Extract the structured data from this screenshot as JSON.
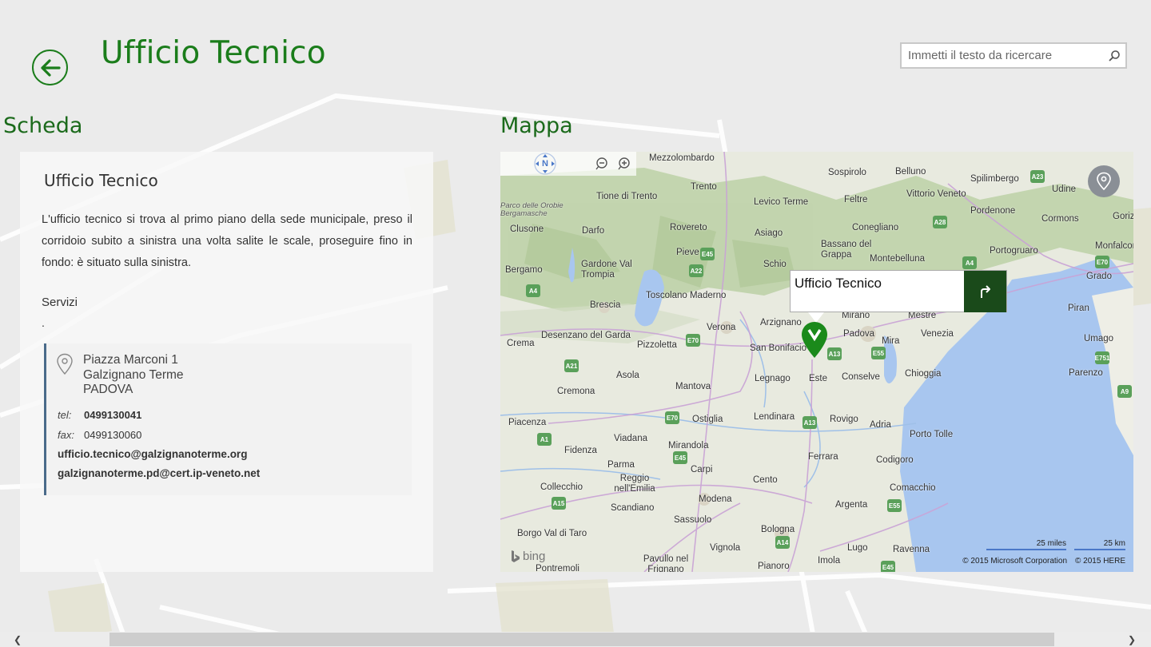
{
  "header": {
    "title": "Ufficio Tecnico",
    "search_placeholder": "Immetti il testo da ricercare"
  },
  "sections": {
    "scheda": "Scheda",
    "mappa": "Mappa"
  },
  "card": {
    "title": "Ufficio Tecnico",
    "description": "L'ufficio tecnico si trova al primo piano della sede municipale, preso il corridoio subito a sinistra una volta salite le scale, proseguire fino in fondo: è situato sulla sinistra.",
    "services_label": "Servizi",
    "services_value": ".",
    "address": [
      "Piazza Marconi 1",
      "Galzignano Terme",
      "PADOVA"
    ],
    "tel_label": "tel:",
    "tel": "0499130041",
    "fax_label": "fax:",
    "fax": "0499130060",
    "email": "ufficio.tecnico@galzignanoterme.org",
    "pec": "galzignanoterme.pd@cert.ip-veneto.net"
  },
  "map": {
    "compass": "N",
    "popup_title": "Ufficio Tecnico",
    "bing": "bing",
    "scale_miles": "25 miles",
    "scale_km": "25 km",
    "copyright_ms": "© 2015 Microsoft Corporation",
    "copyright_here": "© 2015 HERE",
    "labels": [
      "Mezzolombardo",
      "Sospirolo",
      "Belluno",
      "Spilimbergo",
      "Udine",
      "Tione di Trento",
      "Trento",
      "Levico Terme",
      "Feltre",
      "Vittorio Veneto",
      "Pordenone",
      "Cormons",
      "Gorizia",
      "Parco delle Orobie Bergamasche",
      "Clusone",
      "Darfo",
      "Rovereto",
      "Asiago",
      "Conegliano",
      "Monfalcone",
      "Bassano del Grappa",
      "Portogruaro",
      "Pieve",
      "Schio",
      "Montebelluna",
      "Bergamo",
      "Gardone Val Trompia",
      "Grado",
      "Toscolano Maderno",
      "Brescia",
      "Mirano",
      "Mestre",
      "Piran",
      "Arzignano",
      "Padova",
      "Venezia",
      "Desenzano del Garda",
      "Verona",
      "Umago",
      "Crema",
      "Pizzoletta",
      "San Bonifacio",
      "Mira",
      "Chioggia",
      "Parenzo",
      "Asola",
      "Legnago",
      "Este",
      "Conselve",
      "Cremona",
      "Mantova",
      "Piacenza",
      "Ostiglia",
      "Lendinara",
      "Rovigo",
      "Adria",
      "Viadana",
      "Porto Tolle",
      "Fidenza",
      "Mirandola",
      "Ferrara",
      "Codigoro",
      "Parma",
      "Carpi",
      "Collecchio",
      "Reggio nell'Emilia",
      "Cento",
      "Comacchio",
      "Scandiano",
      "Modena",
      "Argenta",
      "Sassuolo",
      "Borgo Val di Taro",
      "Bologna",
      "Lugo",
      "Vignola",
      "Ravenna",
      "Pavullo nel Frignano",
      "Imola",
      "Pontremoli",
      "Pianoro"
    ],
    "roads": [
      "A23",
      "A28",
      "A4",
      "E70",
      "A22",
      "E45",
      "A4",
      "E70",
      "A13",
      "E55",
      "E751",
      "A21",
      "E70",
      "A1",
      "E45",
      "A13",
      "A9",
      "E55",
      "A15",
      "A14",
      "E45"
    ]
  },
  "colors": {
    "accent": "#1b7d1b",
    "popup_dir_bg": "#1a4a1a",
    "sea": "#a8c6ef"
  }
}
